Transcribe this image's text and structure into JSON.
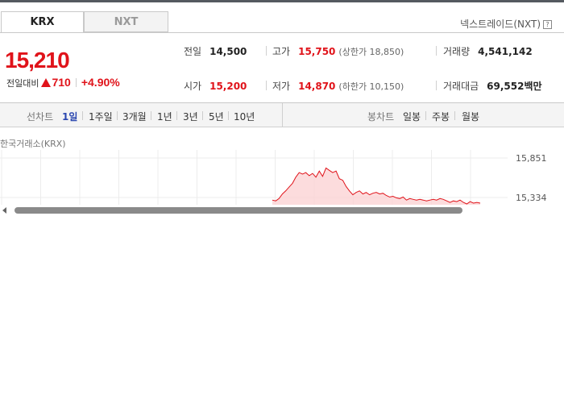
{
  "tabs": [
    {
      "label": "KRX",
      "active": true
    },
    {
      "label": "NXT",
      "active": false
    }
  ],
  "nxt_title": "넥스트레이드(NXT)",
  "help_icon": "?",
  "price": {
    "current": "15,210",
    "change_label": "전일대비",
    "change_amount": "710",
    "change_percent": "+4.90%",
    "direction": "up"
  },
  "stats": {
    "prev_close": {
      "label": "전일",
      "value": "14,500"
    },
    "open": {
      "label": "시가",
      "value": "15,200"
    },
    "high": {
      "label": "고가",
      "value": "15,750",
      "sub": "(상한가 18,850)"
    },
    "low": {
      "label": "저가",
      "value": "14,870",
      "sub": "(하한가 10,150)"
    },
    "volume": {
      "label": "거래량",
      "value": "4,541,142"
    },
    "amount": {
      "label": "거래대금",
      "value": "69,552",
      "unit": "백만"
    }
  },
  "toolbar": {
    "line_label": "선차트",
    "line_items": [
      "1일",
      "1주일",
      "3개월",
      "1년",
      "3년",
      "5년",
      "10년"
    ],
    "active_item": "1일",
    "candle_label": "봉차트",
    "candle_items": [
      "일봉",
      "주봉",
      "월봉"
    ]
  },
  "chart_title": "한국거래소(KRX)",
  "chart_data": {
    "type": "area",
    "y_ticks": [
      15851,
      15334
    ],
    "y_tick_labels": [
      "15,851",
      "15,334"
    ],
    "ylim": [
      15100,
      16000
    ],
    "grid": true,
    "x": [
      0,
      1,
      2,
      3,
      4,
      5,
      6,
      7,
      8,
      9,
      10,
      11,
      12,
      13,
      14,
      15,
      16,
      17,
      18,
      19,
      20,
      21,
      22,
      23,
      24,
      25,
      26,
      27,
      28,
      29,
      30,
      31,
      32,
      33,
      34,
      35,
      36,
      37,
      38,
      39,
      40,
      41,
      42,
      43,
      44,
      45,
      46,
      47,
      48,
      49,
      50,
      51,
      52,
      53,
      54,
      55,
      56,
      57,
      58,
      59,
      60,
      61,
      62
    ],
    "values": [
      15300,
      15290,
      15320,
      15380,
      15420,
      15470,
      15520,
      15600,
      15660,
      15640,
      15660,
      15620,
      15650,
      15600,
      15680,
      15610,
      15720,
      15690,
      15660,
      15680,
      15580,
      15560,
      15480,
      15420,
      15370,
      15400,
      15420,
      15380,
      15400,
      15370,
      15390,
      15400,
      15380,
      15390,
      15360,
      15340,
      15350,
      15330,
      15320,
      15340,
      15300,
      15320,
      15310,
      15300,
      15310,
      15300,
      15290,
      15300,
      15310,
      15300,
      15320,
      15310,
      15290,
      15270,
      15290,
      15280,
      15300,
      15270,
      15250,
      15280,
      15260,
      15270,
      15260
    ],
    "line_color": "#e0131a",
    "fill_color": "#fbd3d5"
  },
  "colors": {
    "up": "#e0131a",
    "active_tab": "#2b47b0"
  }
}
